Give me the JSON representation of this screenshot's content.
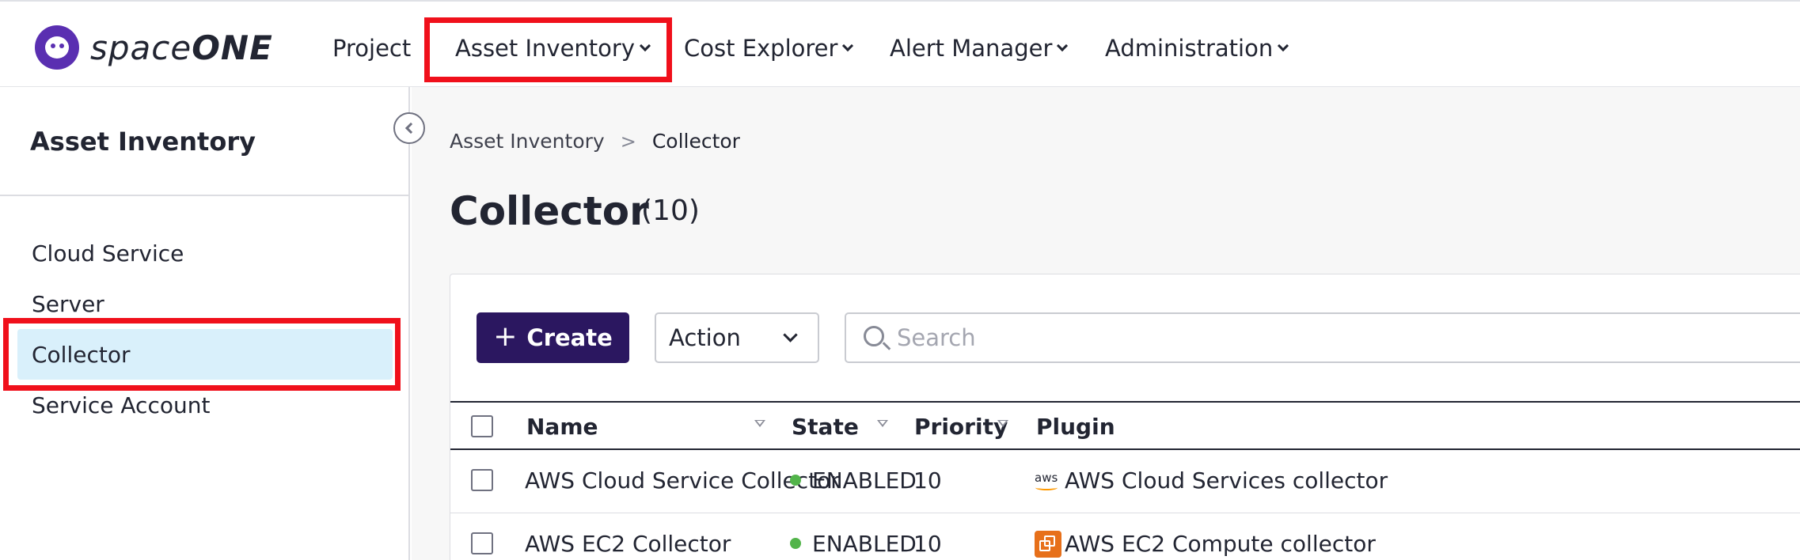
{
  "app": {
    "logo_prefix": "spac",
    "logo_mid": "e",
    "logo_suffix": "ONE",
    "brand_color": "#5a2fb1"
  },
  "nav": {
    "items": [
      {
        "label": "Project",
        "has_dropdown": false
      },
      {
        "label": "Asset Inventory",
        "has_dropdown": true
      },
      {
        "label": "Cost Explorer",
        "has_dropdown": true
      },
      {
        "label": "Alert Manager",
        "has_dropdown": true
      },
      {
        "label": "Administration",
        "has_dropdown": true
      }
    ]
  },
  "sidebar": {
    "title": "Asset Inventory",
    "items": [
      {
        "label": "Cloud Service",
        "active": false
      },
      {
        "label": "Server",
        "active": false
      },
      {
        "label": "Collector",
        "active": true
      },
      {
        "label": "Service Account",
        "active": false
      }
    ]
  },
  "breadcrumb": {
    "parent": "Asset Inventory",
    "separator": ">",
    "current": "Collector"
  },
  "page": {
    "title": "Collector",
    "count": "(10)"
  },
  "toolbar": {
    "create_plus": "+",
    "create_label": "Create",
    "action_label": "Action",
    "search_placeholder": "Search"
  },
  "table": {
    "columns": [
      "Name",
      "State",
      "Priority",
      "Plugin"
    ],
    "rows": [
      {
        "name": "AWS Cloud Service Collector",
        "state": "ENABLED",
        "priority": "10",
        "plugin_icon": "aws",
        "plugin": "AWS Cloud Services collector"
      },
      {
        "name": "AWS EC2 Collector",
        "state": "ENABLED",
        "priority": "10",
        "plugin_icon": "ec2",
        "plugin": "AWS EC2 Compute collector"
      }
    ]
  },
  "icons": {
    "aws_logo_text": "aws"
  },
  "colors": {
    "highlight_box": "#f0101b",
    "create_button": "#2b1760",
    "active_sidebar": "#d9f0fb",
    "enabled_dot": "#52b44a"
  }
}
